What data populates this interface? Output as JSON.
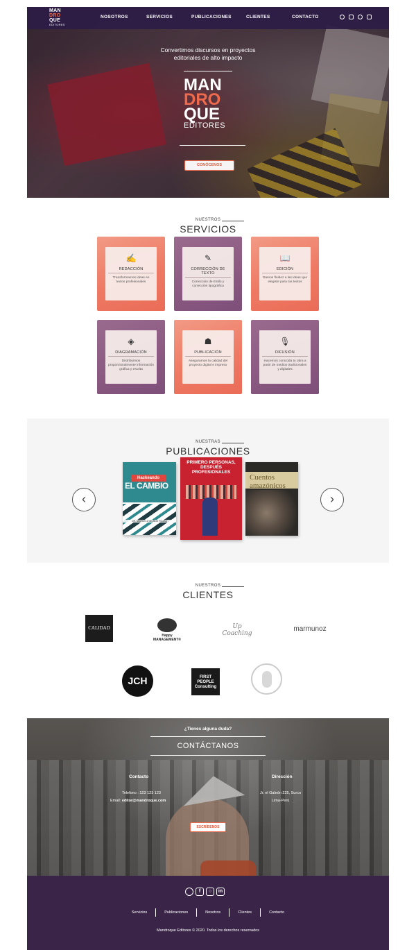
{
  "nav": {
    "links": [
      "NOSOTROS",
      "SERVICIOS",
      "PUBLICACIONES",
      "CLIENTES",
      "CONTACTO"
    ],
    "logo_lines": [
      "MAN",
      "DRO",
      "QUE",
      "EDITORES"
    ],
    "social_icons": [
      "whatsapp-icon",
      "facebook-icon",
      "instagram-icon",
      "linkedin-icon"
    ]
  },
  "hero": {
    "tagline_1": "Convertimos discursos en proyectos",
    "tagline_2": "editoriales de alto impacto",
    "logo_lines": [
      "MAN",
      "DRO",
      "QUE"
    ],
    "logo_sub": "EDITORES",
    "button_label": "CONÓCENOS"
  },
  "services": {
    "pre": "NUESTROS",
    "title": "SERVICIOS",
    "items": [
      {
        "name": "REDACCIÓN",
        "desc": "Transformamos ideas en textos profesionales",
        "icon": "writing-hand-icon",
        "color": "coral"
      },
      {
        "name": "CORRECCIÓN DE TEXTO",
        "desc": "Corrección de Estilo y corrección tipográfica",
        "icon": "edit-document-icon",
        "color": "purple"
      },
      {
        "name": "EDICIÓN",
        "desc": "Damos fluidez a las ideas que elegiste para tus textos",
        "icon": "open-book-icon",
        "color": "coral"
      },
      {
        "name": "DIAGRAMACIÓN",
        "desc": "Distribuimos proporcionalmente información gráfica y escrita",
        "icon": "layers-icon",
        "color": "purple"
      },
      {
        "name": "PUBLICACIÓN",
        "desc": "Aseguramos la calidad del proyecto digital e impreso",
        "icon": "reader-icon",
        "color": "coral"
      },
      {
        "name": "DIFUSIÓN",
        "desc": "Hacemos conocida tu obra a partir de medios tradicionales y digitales",
        "icon": "microphone-icon",
        "color": "purple"
      }
    ]
  },
  "publications": {
    "pre": "NUESTRAS",
    "title": "PUBLICACIONES",
    "books": [
      {
        "title_top": "Hackeando",
        "title_main": "EL CAMBIO",
        "author": "DR. MARCELO MUÑOZ ROJAS"
      },
      {
        "title": "PRIMERO PERSONAS, DESPUÉS PROFESIONALES"
      },
      {
        "title": "Cuentos amazónicos"
      }
    ],
    "prev_icon": "chevron-left-icon",
    "next_icon": "chevron-right-icon"
  },
  "clients": {
    "pre": "NUESTROS",
    "title": "CLIENTES",
    "logos": [
      "CALIDAD",
      "Happy MANAGEMENT®",
      "Up Coaching",
      "marmunoz",
      "JCH",
      "FIRST PEOPLE Consulting",
      ""
    ]
  },
  "contact": {
    "question": "¿Tienes alguna duda?",
    "title": "CONTÁCTANOS",
    "contact_heading": "Contacto",
    "phone": "Telefono : 123 123 123",
    "email_label": "Email:",
    "email": "editor@mandroque.com",
    "address_heading": "Dirección",
    "address_1": "Jr. el Galeón 225, Surco",
    "address_2": "Lima-Perú",
    "button_label": "ESCRÍBENOS"
  },
  "footer": {
    "links": [
      "Servicios",
      "Publicaciones",
      "Nosotros",
      "Clientes",
      "Contacto"
    ],
    "copyright": "Mandroque Editores © 2020. Todos los derechos reservados"
  }
}
